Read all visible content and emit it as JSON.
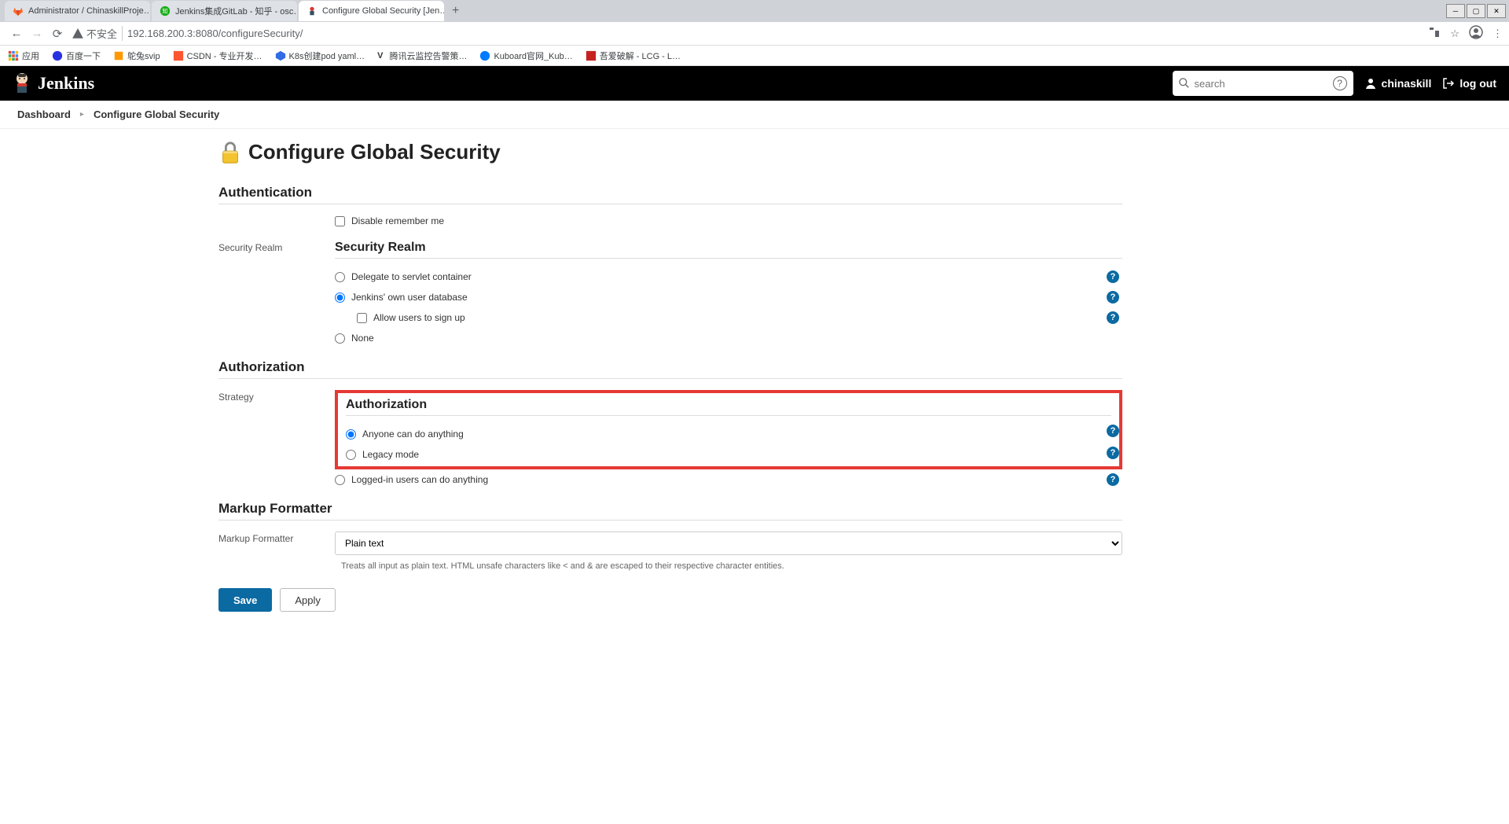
{
  "browser": {
    "tabs": [
      {
        "label": "Administrator / ChinaskillProje…",
        "active": false
      },
      {
        "label": "Jenkins集成GitLab - 知乎 - osc…",
        "active": false
      },
      {
        "label": "Configure Global Security [Jen…",
        "active": true
      }
    ],
    "urlWarn": "不安全",
    "url": "192.168.200.3:8080/configureSecurity/",
    "bookmarks": [
      "应用",
      "百度一下",
      "鸵兔svip",
      "CSDN - 专业开发…",
      "K8s创建pod yaml…",
      "腾讯云监控告警策…",
      "Kuboard官网_Kub…",
      "吾爱破解 - LCG - L…"
    ]
  },
  "header": {
    "brand": "Jenkins",
    "searchPlaceholder": "search",
    "user": "chinaskill",
    "logout": "log out"
  },
  "breadcrumb": {
    "items": [
      "Dashboard",
      "Configure Global Security"
    ]
  },
  "page": {
    "title": "Configure Global Security",
    "sections": {
      "authentication": {
        "title": "Authentication",
        "disableRemember": "Disable remember me",
        "securityRealmLabel": "Security Realm",
        "subTitle": "Security Realm",
        "options": {
          "delegate": "Delegate to servlet container",
          "ownDb": "Jenkins' own user database",
          "allowSignup": "Allow users to sign up",
          "none": "None"
        }
      },
      "authorization": {
        "title": "Authorization",
        "strategyLabel": "Strategy",
        "subTitle": "Authorization",
        "options": {
          "anyone": "Anyone can do anything",
          "legacy": "Legacy mode",
          "loggedIn": "Logged-in users can do anything"
        }
      },
      "markup": {
        "title": "Markup Formatter",
        "label": "Markup Formatter",
        "selected": "Plain text",
        "helpText": "Treats all input as plain text. HTML unsafe characters like < and & are escaped to their respective character entities."
      }
    },
    "buttons": {
      "save": "Save",
      "apply": "Apply"
    }
  },
  "colors": {
    "primary": "#0b6aa2",
    "highlight": "#e53935"
  }
}
